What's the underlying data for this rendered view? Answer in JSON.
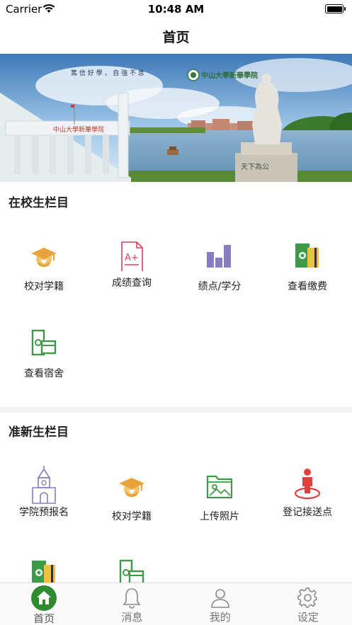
{
  "status_bar": {
    "carrier": "Carrier",
    "time": "10:48 AM"
  },
  "nav": {
    "title": "首页"
  },
  "banner": {
    "logo_text": "中山大學新華學院",
    "gate_text": "中山大學新華學院",
    "monument_text": "天下為公",
    "calligraphy": "篤 信 好 學 ， 自 強 不 息"
  },
  "section_current": {
    "title": "在校生栏目",
    "items": [
      {
        "label": "校对学籍",
        "icon": "graduation-cap-icon"
      },
      {
        "label": "成绩查询",
        "icon": "grade-document-icon"
      },
      {
        "label": "绩点/学分",
        "icon": "bar-chart-icon"
      },
      {
        "label": "查看缴费",
        "icon": "money-card-icon"
      },
      {
        "label": "查看宿舍",
        "icon": "cash-card-icon"
      }
    ]
  },
  "section_new": {
    "title": "准新生栏目",
    "items": [
      {
        "label": "学院预报名",
        "icon": "church-icon"
      },
      {
        "label": "校对学籍",
        "icon": "graduation-cap-icon"
      },
      {
        "label": "上传照片",
        "icon": "photo-folder-icon"
      },
      {
        "label": "登记接送点",
        "icon": "person-location-icon"
      },
      {
        "label": "",
        "icon": "money-card-icon"
      },
      {
        "label": "",
        "icon": "cash-card-icon"
      }
    ]
  },
  "tab_bar": {
    "tabs": [
      {
        "label": "首页",
        "icon": "home-icon",
        "active": true
      },
      {
        "label": "消息",
        "icon": "bell-icon",
        "active": false
      },
      {
        "label": "我的",
        "icon": "user-icon",
        "active": false
      },
      {
        "label": "设定",
        "icon": "gear-icon",
        "active": false
      }
    ]
  },
  "colors": {
    "accent_green": "#2e8b2e",
    "cap_orange": "#e8a33a",
    "chart_purple": "#8a7cc0",
    "grade_red": "#d0475a",
    "money_green": "#3d9b48",
    "card_yellow": "#f0c23a",
    "pin_red": "#e0413e"
  }
}
